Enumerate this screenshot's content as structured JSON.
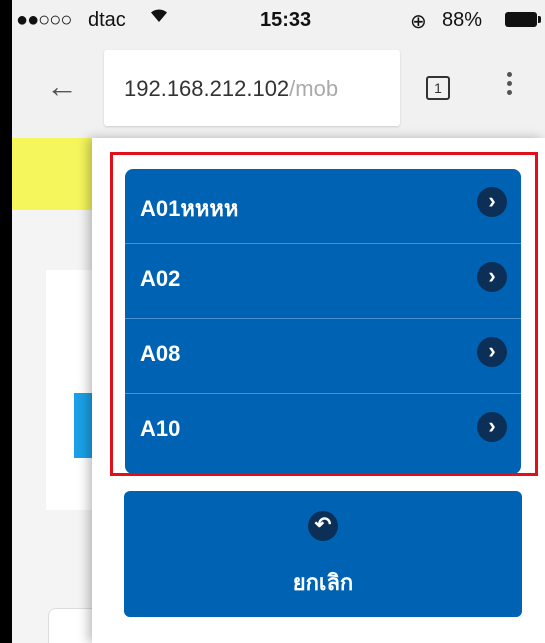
{
  "status_bar": {
    "signal": "●●○○○",
    "carrier": "dtac",
    "time": "15:33",
    "lock": "⊕",
    "battery_percent": "88%"
  },
  "browser": {
    "url_dark": "192.168.212.102",
    "url_light": "/mob",
    "tab_count": "1"
  },
  "menu_items": [
    {
      "label": "A01หหหห"
    },
    {
      "label": "A02"
    },
    {
      "label": "A08"
    },
    {
      "label": "A10"
    }
  ],
  "cancel_button": {
    "label": "ยกเลิก"
  },
  "colors": {
    "primary": "#0062b2",
    "icon_bg": "#0b2f56",
    "highlight": "#e0101a"
  }
}
